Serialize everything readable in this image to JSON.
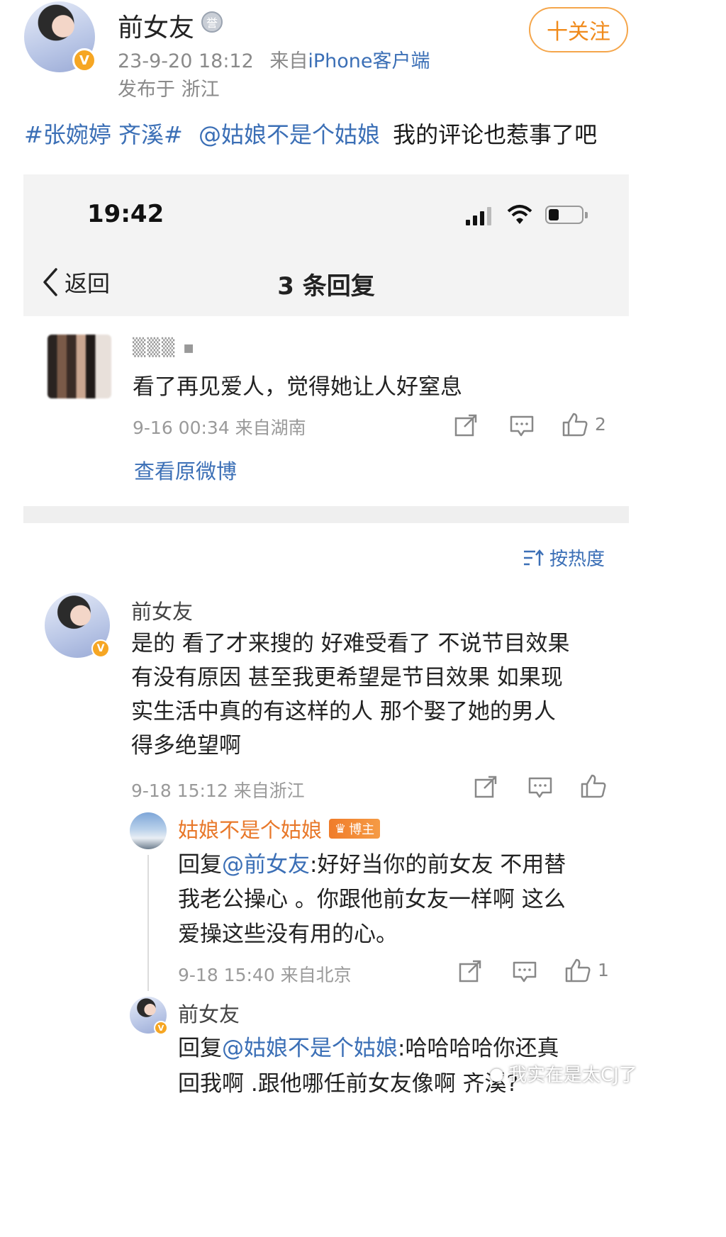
{
  "post": {
    "author": "前女友",
    "medal_glyph": "誉",
    "time": "23-9-20 18:12",
    "source_prefix": "来自",
    "source": "iPhone客户端",
    "location": "发布于 浙江",
    "follow_label": "十关注",
    "text": {
      "topic": "#张婉婷 齐溪#",
      "mention": "@姑娘不是个姑娘",
      "rest": "我的评论也惹事了吧"
    }
  },
  "screenshot": {
    "status_time": "19:42",
    "nav": {
      "back_label": "返回",
      "title": "3 条回复"
    },
    "original_comment": {
      "username": "▒▒▒ ▪",
      "text": "看了再见爱人，觉得她让人好窒息",
      "meta": "9-16 00:34 来自湖南",
      "like_count": "2",
      "view_original": "查看原微博"
    },
    "sort_label": "按热度",
    "reply_main": {
      "username": "前女友",
      "lines": [
        "是的 看了才来搜的 好难受看了 不说节目效果",
        "有没有原因 甚至我更希望是节目效果 如果现",
        "实生活中真的有这样的人 那个娶了她的男人",
        "得多绝望啊"
      ],
      "meta": "9-18 15:12 来自浙江"
    },
    "reply_sub1": {
      "username": "姑娘不是个姑娘",
      "badge": "博主",
      "reply_prefix": "回复",
      "mention": "@前女友",
      "line1_rest": ":好好当你的前女友 不用替",
      "line2": "我老公操心 。你跟他前女友一样啊 这么",
      "line3": "爱操这些没有用的心。",
      "meta": "9-18 15:40 来自北京",
      "like_count": "1"
    },
    "reply_sub2": {
      "username": "前女友",
      "reply_prefix": "回复",
      "mention": "@姑娘不是个姑娘",
      "line1_rest": ":哈哈哈哈你还真",
      "line2": "回我啊 .跟他哪任前女友像啊 齐溪?"
    }
  },
  "watermark": "我实在是太CJ了",
  "colors": {
    "link": "#3b6fb6",
    "follow": "#f08a1b",
    "verified": "#f6a623",
    "hot_name": "#e8782a"
  }
}
